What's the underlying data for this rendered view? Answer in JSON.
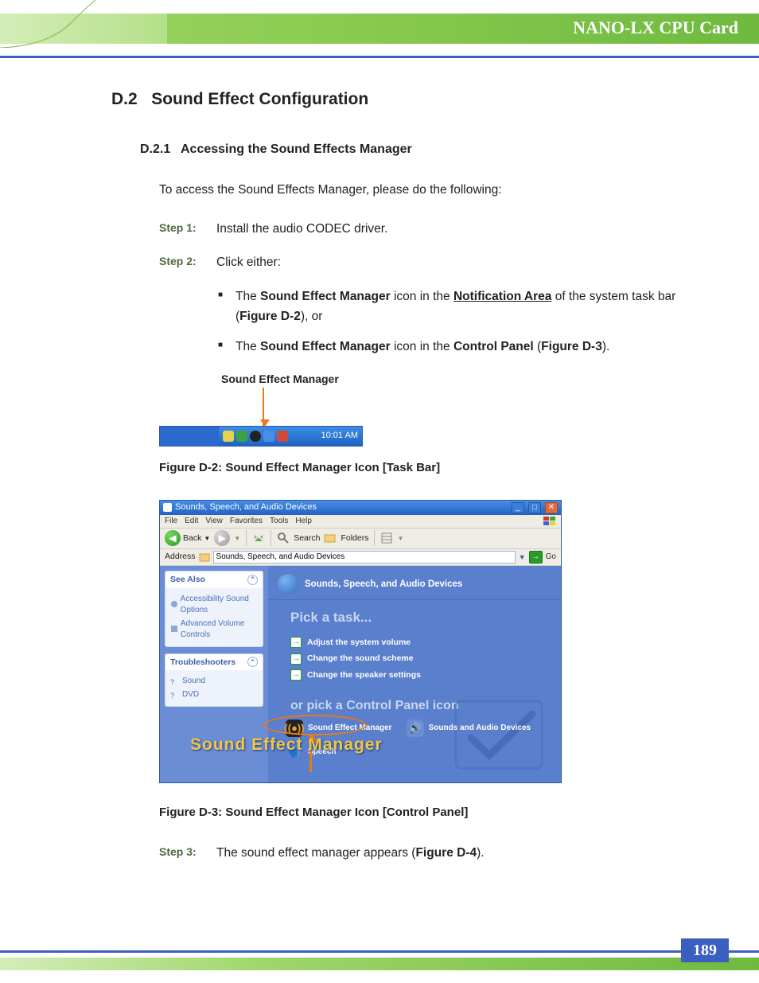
{
  "header": {
    "title": "NANO-LX CPU Card"
  },
  "section": {
    "number": "D.2",
    "title": "Sound Effect Configuration"
  },
  "subsection": {
    "number": "D.2.1",
    "title": "Accessing the Sound Effects Manager"
  },
  "intro": "To access the Sound Effects Manager, please do the following:",
  "steps": {
    "1": {
      "label": "Step 1:",
      "text": "Install the audio CODEC driver."
    },
    "2": {
      "label": "Step 2:",
      "text": "Click either:"
    },
    "3": {
      "label": "Step 3:",
      "prefix": "The sound effect manager appears (",
      "ref": "Figure D-4",
      "suffix": ")."
    }
  },
  "bullets": {
    "a": {
      "t1": "The ",
      "b1": "Sound Effect Manager",
      "t2": " icon in the ",
      "b2": "Notification Area",
      "t3": " of the system task bar (",
      "b3": "Figure D-2",
      "t4": "), or"
    },
    "b": {
      "t1": "The ",
      "b1": "Sound Effect Manager",
      "t2": " icon in the ",
      "b2": "Control Panel",
      "t3": " (",
      "b3": "Figure D-3",
      "t4": ")."
    }
  },
  "fig1": {
    "label": "Sound Effect Manager",
    "time": "10:01 AM",
    "caption": "Figure D-2: Sound Effect Manager Icon [Task Bar]"
  },
  "fig2": {
    "caption": "Figure D-3: Sound Effect Manager Icon [Control Panel]",
    "annotation": "Sound Effect Manager"
  },
  "cp": {
    "title": "Sounds, Speech, and Audio Devices",
    "menu": [
      "File",
      "Edit",
      "View",
      "Favorites",
      "Tools",
      "Help"
    ],
    "toolbar": {
      "back": "Back",
      "search": "Search",
      "folders": "Folders"
    },
    "address_label": "Address",
    "address_value": "Sounds, Speech, and Audio Devices",
    "go": "Go",
    "side": {
      "see_also": {
        "title": "See Also",
        "items": [
          "Accessibility Sound Options",
          "Advanced Volume Controls"
        ]
      },
      "troubleshooters": {
        "title": "Troubleshooters",
        "items": [
          "Sound",
          "DVD"
        ]
      }
    },
    "main": {
      "heading": "Sounds, Speech, and Audio Devices",
      "pick": "Pick a task...",
      "tasks": [
        "Adjust the system volume",
        "Change the sound scheme",
        "Change the speaker settings"
      ],
      "orpick": "or pick a Control Panel icon",
      "icons": {
        "sem": "Sound Effect Manager",
        "sad": "Sounds and Audio Devices",
        "speech": "Speech"
      }
    }
  },
  "page_number": "189"
}
